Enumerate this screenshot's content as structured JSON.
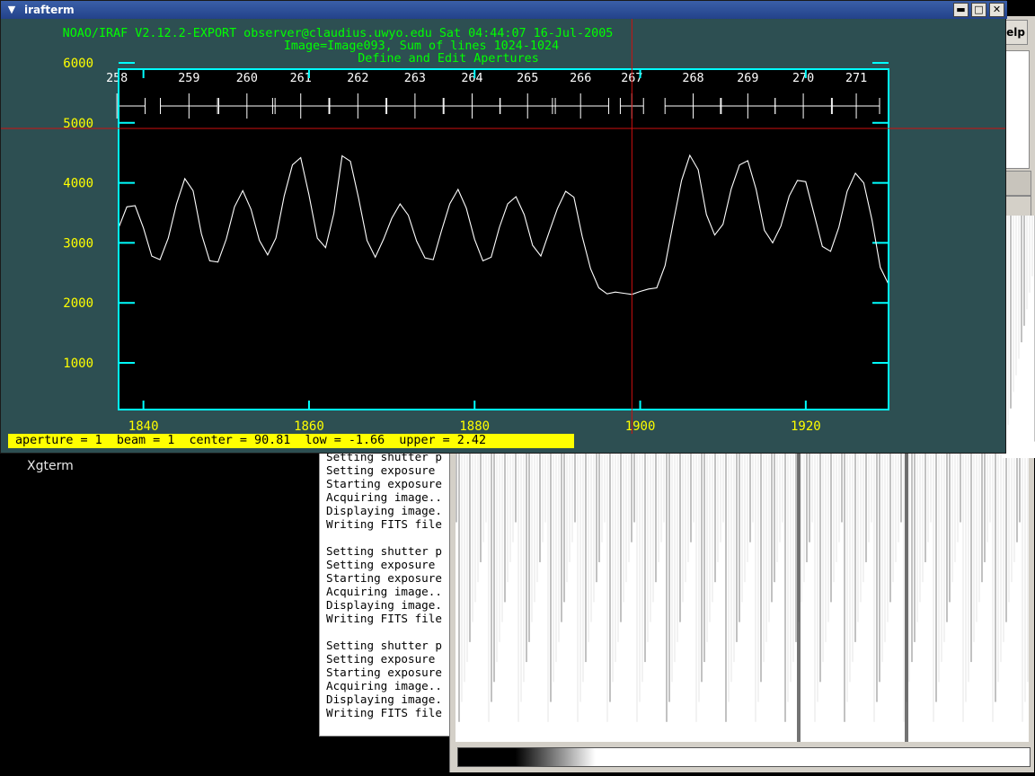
{
  "desktop": {
    "label": "Xgterm"
  },
  "side_window": {
    "help_label": "elp"
  },
  "xgterm": {
    "lines": [
      "Setting shutter p",
      "Setting exposure",
      "Starting exposure",
      "Acquiring image..",
      "Displaying image.",
      "Writing FITS file",
      "",
      "Setting shutter p",
      "Setting exposure",
      "Starting exposure",
      "Acquiring image..",
      "Displaying image.",
      "Writing FITS file",
      "",
      "Setting shutter p",
      "Setting exposure",
      "Starting exposure",
      "Acquiring image..",
      "Displaying image.",
      "Writing FITS file"
    ]
  },
  "window": {
    "title": "irafterm",
    "icons": {
      "menu": "chevron-down-icon",
      "minimize": "minimize-icon",
      "maximize": "maximize-icon",
      "close": "close-icon"
    }
  },
  "plot": {
    "header_line1": "NOAO/IRAF V2.12.2-EXPORT observer@claudius.uwyo.edu Sat 04:44:07 16-Jul-2005",
    "header_line2": "Image=Image093, Sum of lines 1024-1024",
    "header_line3": "Define and Edit Apertures",
    "colors": {
      "background": "#2d4f52",
      "frame": "#00ffff",
      "header": "#00ff00",
      "ytick": "#ffff00",
      "xtick": "#ffff00",
      "trace": "#ffffff",
      "cursor": "#d01010",
      "plot_bg": "#000000",
      "status_bg": "#ffff00"
    },
    "cursor_x": 1899
  },
  "status_bar": {
    "text": "aperture = 1  beam = 1  center = 90.81  low = -1.66  upper = 2.42"
  },
  "chart_data": {
    "type": "line",
    "title": "Define and Edit Apertures",
    "xlabel": "",
    "ylabel": "",
    "xlim": [
      1837,
      1930
    ],
    "ylim": [
      0,
      6000
    ],
    "xticks": [
      1840,
      1860,
      1880,
      1900,
      1920
    ],
    "yticks": [
      1000,
      2000,
      3000,
      4000,
      5000,
      6000
    ],
    "grid": false,
    "series": [
      {
        "x": [
          1837,
          1838,
          1839,
          1840,
          1841,
          1842,
          1843,
          1844,
          1845,
          1846,
          1847,
          1848,
          1849,
          1850,
          1851,
          1852,
          1853,
          1854,
          1855,
          1856,
          1857,
          1858,
          1859,
          1860,
          1861,
          1862,
          1863,
          1864,
          1865,
          1866,
          1867,
          1868,
          1869,
          1870,
          1871,
          1872,
          1873,
          1874,
          1875,
          1876,
          1877,
          1878,
          1879,
          1880,
          1881,
          1882,
          1883,
          1884,
          1885,
          1886,
          1887,
          1888,
          1889,
          1890,
          1891,
          1892,
          1893,
          1894,
          1895,
          1896,
          1897,
          1898,
          1899,
          1900,
          1901,
          1902,
          1903,
          1904,
          1905,
          1906,
          1907,
          1908,
          1909,
          1910,
          1911,
          1912,
          1913,
          1914,
          1915,
          1916,
          1917,
          1918,
          1919,
          1920,
          1921,
          1922,
          1923,
          1924,
          1925,
          1926,
          1927,
          1928,
          1929,
          1930
        ],
        "y": [
          3250,
          3600,
          3620,
          3250,
          2780,
          2720,
          3080,
          3650,
          4070,
          3870,
          3150,
          2700,
          2680,
          3060,
          3600,
          3870,
          3560,
          3040,
          2800,
          3080,
          3780,
          4300,
          4420,
          3800,
          3080,
          2920,
          3490,
          4450,
          4360,
          3740,
          3040,
          2760,
          3060,
          3410,
          3650,
          3460,
          3030,
          2750,
          2720,
          3200,
          3650,
          3890,
          3580,
          3060,
          2700,
          2760,
          3260,
          3650,
          3770,
          3470,
          2960,
          2780,
          3180,
          3570,
          3860,
          3760,
          3110,
          2570,
          2250,
          2150,
          2180,
          2160,
          2140,
          2190,
          2230,
          2250,
          2620,
          3340,
          4040,
          4460,
          4220,
          3470,
          3130,
          3310,
          3900,
          4300,
          4370,
          3890,
          3210,
          3000,
          3280,
          3780,
          4040,
          4020,
          3480,
          2940,
          2860,
          3260,
          3860,
          4160,
          4000,
          3380,
          2590,
          2310
        ]
      }
    ],
    "apertures": [
      {
        "label": "258",
        "x": 1836.8,
        "width": 6.8
      },
      {
        "label": "259",
        "x": 1845.5,
        "width": 6.9
      },
      {
        "label": "260",
        "x": 1852.5,
        "width": 6.8
      },
      {
        "label": "261",
        "x": 1859.0,
        "width": 6.8
      },
      {
        "label": "262",
        "x": 1865.9,
        "width": 6.8
      },
      {
        "label": "263",
        "x": 1872.8,
        "width": 6.8
      },
      {
        "label": "264",
        "x": 1879.7,
        "width": 6.8
      },
      {
        "label": "265",
        "x": 1886.4,
        "width": 6.7
      },
      {
        "label": "266",
        "x": 1892.8,
        "width": 6.8
      },
      {
        "label": "267",
        "x": 1899.0,
        "width": 2.8
      },
      {
        "label": "268",
        "x": 1906.4,
        "width": 6.8
      },
      {
        "label": "269",
        "x": 1913.0,
        "width": 6.6
      },
      {
        "label": "270",
        "x": 1919.7,
        "width": 6.8
      },
      {
        "label": "271",
        "x": 1926.1,
        "width": 5.8
      }
    ]
  }
}
